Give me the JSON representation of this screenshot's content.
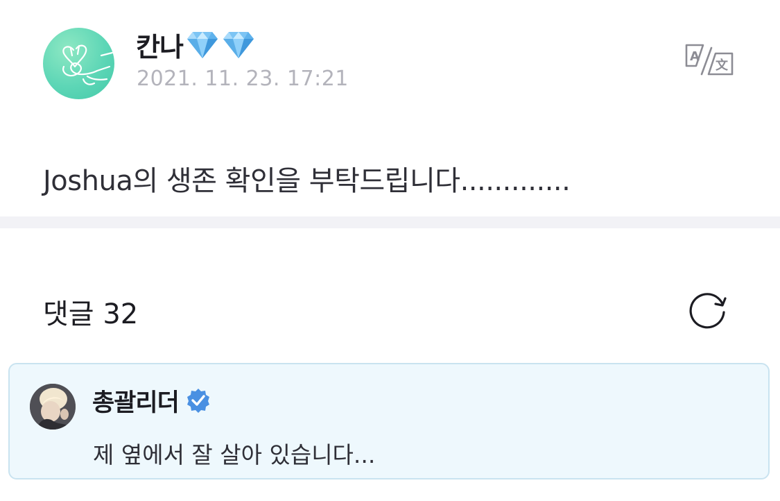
{
  "post": {
    "author_name": "칸나",
    "author_badges": [
      "diamond-icon",
      "diamond-icon"
    ],
    "date": "2021. 11. 23. 17:21",
    "body": "Joshua의 생존 확인을 부탁드립니다.............",
    "translate_icon": "translate-icon"
  },
  "comments": {
    "title": "댓글 32",
    "refresh_icon": "refresh-icon",
    "highlighted": {
      "author_name": "총괄리더",
      "verified_icon": "verified-icon",
      "text": "제 옆에서 잘 살아 있습니다..."
    }
  },
  "colors": {
    "comment_background": "#eef8fd",
    "comment_border": "#c9e3f0",
    "verified_blue": "#4a90e2",
    "date_gray": "#b3b3bb",
    "avatar_mint": "#5dd6b6"
  }
}
